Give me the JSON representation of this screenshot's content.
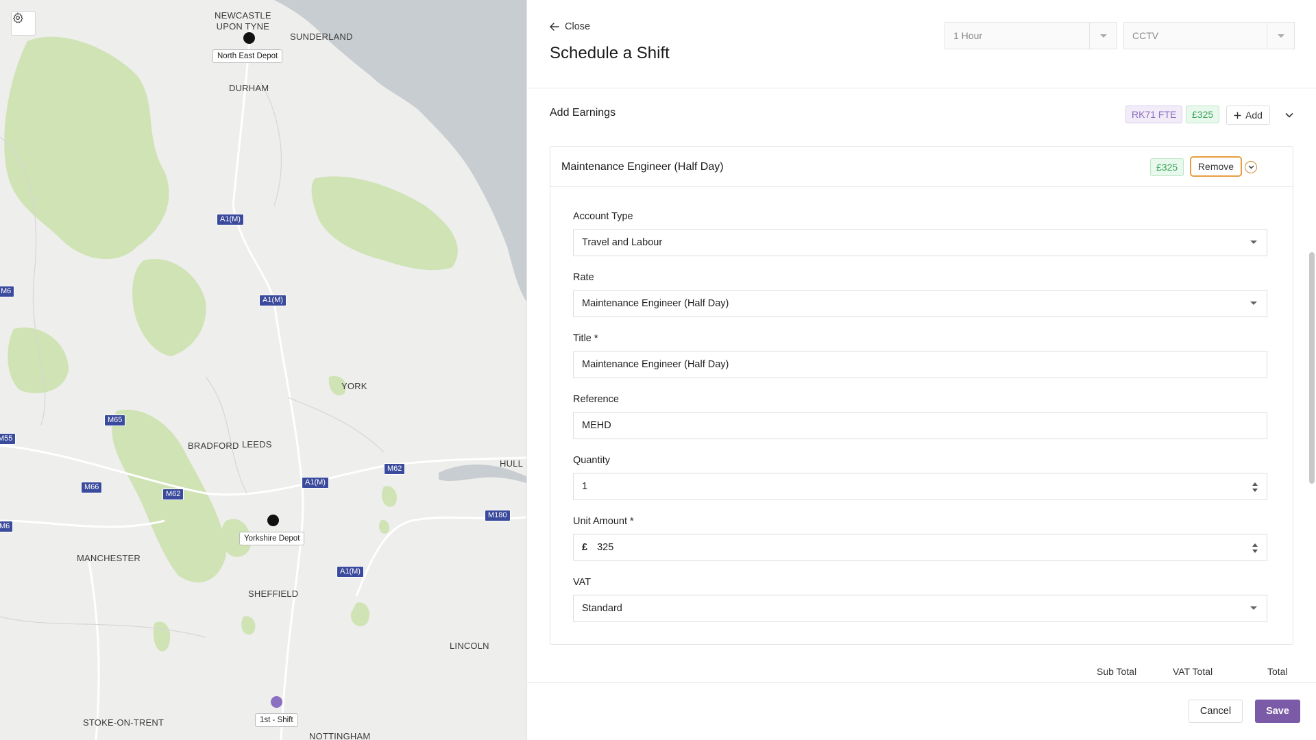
{
  "map": {
    "places": [
      {
        "key": "newcastle",
        "label": "NEWCASTLE\nUPON TYNE"
      },
      {
        "key": "sunderland",
        "label": "SUNDERLAND"
      },
      {
        "key": "durham",
        "label": "DURHAM"
      },
      {
        "key": "york",
        "label": "YORK"
      },
      {
        "key": "bradford",
        "label": "BRADFORD"
      },
      {
        "key": "leeds",
        "label": "LEEDS"
      },
      {
        "key": "hull",
        "label": "HULL"
      },
      {
        "key": "manchester",
        "label": "MANCHESTER"
      },
      {
        "key": "sheffield",
        "label": "SHEFFIELD"
      },
      {
        "key": "lincoln",
        "label": "LINCOLN"
      },
      {
        "key": "stoke",
        "label": "STOKE-ON-TRENT"
      },
      {
        "key": "nottingham",
        "label": "NOTTINGHAM"
      }
    ],
    "roads": [
      "A1(M)",
      "A1(M)",
      "M6",
      "M65",
      "M55",
      "M66",
      "M62",
      "A1(M)",
      "M62",
      "M6",
      "M180",
      "A1(M)"
    ],
    "markers": [
      {
        "label": "North East Depot",
        "color": "#111111"
      },
      {
        "label": "Yorkshire Depot",
        "color": "#111111"
      },
      {
        "label": "1st - Shift",
        "color": "#8d6fc2"
      }
    ],
    "settings_icon": "gear-icon"
  },
  "header": {
    "close_label": "Close",
    "title": "Schedule a Shift",
    "duration_value": "1 Hour",
    "service_value": "CCTV"
  },
  "earnings": {
    "section_label": "Add Earnings",
    "vehicle_chip": "RK71 FTE",
    "total_chip": "£325",
    "add_label": "Add"
  },
  "card": {
    "title": "Maintenance Engineer (Half Day)",
    "price_chip": "£325",
    "remove_label": "Remove",
    "fields": {
      "account_type_label": "Account Type",
      "account_type_value": "Travel and Labour",
      "rate_label": "Rate",
      "rate_value": "Maintenance Engineer (Half Day)",
      "title_label": "Title *",
      "title_value": "Maintenance Engineer (Half Day)",
      "reference_label": "Reference",
      "reference_value": "MEHD",
      "quantity_label": "Quantity",
      "quantity_value": "1",
      "unit_amount_label": "Unit Amount *",
      "currency_symbol": "£",
      "unit_amount_value": "325",
      "vat_label": "VAT",
      "vat_value": "Standard"
    }
  },
  "totals": {
    "sub_total_label": "Sub Total",
    "vat_total_label": "VAT Total",
    "total_label": "Total"
  },
  "footer": {
    "cancel_label": "Cancel",
    "save_label": "Save"
  },
  "colors": {
    "accent": "#7b5ba8",
    "remove_border": "#e79d3f",
    "water": "#c7cdd0",
    "woodland": "#cfe3b5"
  }
}
